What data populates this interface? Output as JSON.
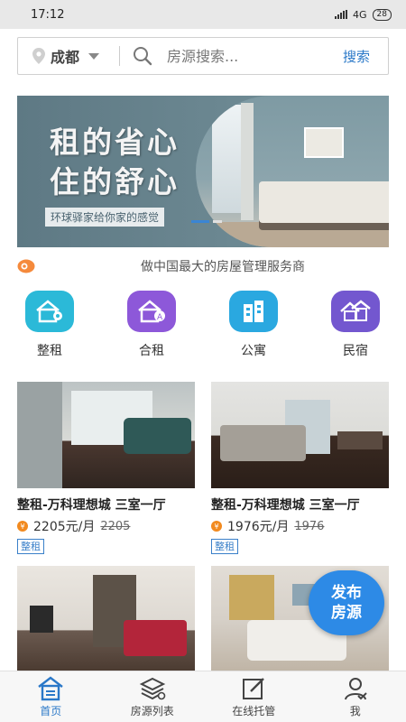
{
  "status_bar": {
    "time": "17:12",
    "network": "4G",
    "battery": "28"
  },
  "search": {
    "city": "成都",
    "placeholder": "房源搜索...",
    "button": "搜索"
  },
  "banner": {
    "title_line1": "租的省心",
    "title_line2": "住的舒心",
    "subtitle": "环球驿家给你家的感觉"
  },
  "notice": {
    "text": "做中国最大的房屋管理服务商"
  },
  "categories": [
    {
      "label": "整租",
      "icon": "house-key-icon",
      "color": "#2bb9d8"
    },
    {
      "label": "合租",
      "icon": "house-people-icon",
      "color": "#8d58d9"
    },
    {
      "label": "公寓",
      "icon": "apartment-icon",
      "color": "#2aa8e0"
    },
    {
      "label": "民宿",
      "icon": "homestay-icon",
      "color": "#7357cf"
    }
  ],
  "listings": [
    {
      "title": "整租-万科理想城 三室一厅",
      "price": "2205元/月",
      "old_price": "2205",
      "tag": "整租"
    },
    {
      "title": "整租-万科理想城 三室一厅",
      "price": "1976元/月",
      "old_price": "1976",
      "tag": "整租"
    },
    {
      "title": "",
      "price": "",
      "old_price": "",
      "tag": ""
    },
    {
      "title": "",
      "price": "",
      "old_price": "",
      "tag": ""
    }
  ],
  "fab": {
    "line1": "发布",
    "line2": "房源"
  },
  "tabbar": [
    {
      "label": "首页",
      "icon": "home-icon",
      "active": true
    },
    {
      "label": "房源列表",
      "icon": "layers-icon",
      "active": false
    },
    {
      "label": "在线托管",
      "icon": "edit-icon",
      "active": false
    },
    {
      "label": "我",
      "icon": "user-icon",
      "active": false
    }
  ],
  "colors": {
    "accent": "#2a78c8",
    "fab": "#2d8ae6",
    "price_icon": "#f28a1f"
  }
}
